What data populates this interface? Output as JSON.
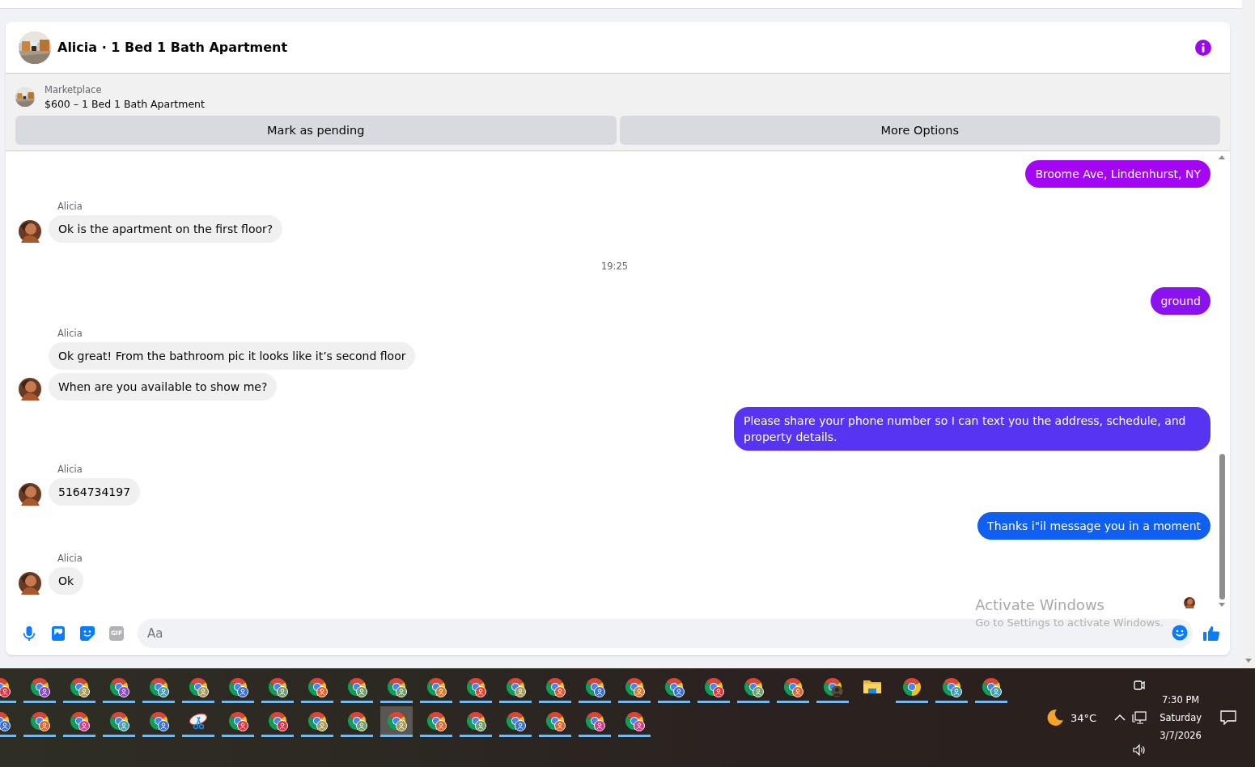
{
  "header": {
    "title": "Alicia · 1 Bed 1 Bath Apartment"
  },
  "listing": {
    "source": "Marketplace",
    "title": "$600 – 1 Bed 1 Bath Apartment",
    "buttons": [
      "Mark as pending",
      "More Options"
    ]
  },
  "messages": [
    {
      "kind": "outgoing",
      "text": "Broome Ave, Lindenhurst, NY",
      "color": "#a405f4"
    },
    {
      "kind": "incoming",
      "sender": "Alicia",
      "bubbles": [
        "Ok is the apartment on the first floor?"
      ]
    },
    {
      "kind": "time",
      "text": "19:25"
    },
    {
      "kind": "outgoing",
      "text": "ground",
      "color": "#8a12f0"
    },
    {
      "kind": "incoming",
      "sender": "Alicia",
      "bubbles": [
        "Ok great! From the bathroom pic it looks like it’s second floor",
        "When are you available to show me?"
      ]
    },
    {
      "kind": "outgoing",
      "text": "Please share your phone number so I can text you the address, schedule, and property details.",
      "color": "#5634f2"
    },
    {
      "kind": "incoming",
      "sender": "Alicia",
      "bubbles": [
        "5164734197"
      ]
    },
    {
      "kind": "outgoing",
      "text": "Thanks i\"il message you in a moment",
      "color": "#0f5ff3"
    },
    {
      "kind": "incoming",
      "sender": "Alicia",
      "bubbles": [
        "Ok"
      ]
    },
    {
      "kind": "seen"
    }
  ],
  "composer": {
    "gif_label": "GIF",
    "placeholder": "Aa"
  },
  "os_notice": {
    "title": "Activate Windows",
    "text": "Go to Settings to activate Windows."
  },
  "taskbar": {
    "rows": [
      [
        {
          "kind": "profile",
          "color": "#e8303d",
          "running": true,
          "selected": false
        },
        {
          "kind": "profile",
          "color": "#8e44c9",
          "running": true,
          "selected": false
        },
        {
          "kind": "profile",
          "color": "#a69a5c",
          "running": true,
          "selected": false
        },
        {
          "kind": "profile",
          "color": "#8e44c9",
          "running": true,
          "selected": false
        },
        {
          "kind": "profile",
          "color": "#3f9fb0",
          "running": true,
          "selected": false
        },
        {
          "kind": "profile",
          "color": "#a69a5c",
          "running": true,
          "selected": false
        },
        {
          "kind": "profile",
          "color": "#3a6fd8",
          "running": true,
          "selected": false
        },
        {
          "kind": "profile",
          "color": "#6f9e6a",
          "running": true,
          "selected": false
        },
        {
          "kind": "profile",
          "color": "#e8602a",
          "running": true,
          "selected": false
        },
        {
          "kind": "profile",
          "color": "#6f9e6a",
          "running": true,
          "selected": false
        },
        {
          "kind": "profile",
          "color": "#6f9e6a",
          "running": true,
          "selected": false
        },
        {
          "kind": "profile",
          "color": "#e07a28",
          "running": true,
          "selected": false
        },
        {
          "kind": "profile",
          "color": "#e8452e",
          "running": true,
          "selected": false
        },
        {
          "kind": "profile",
          "color": "#a69a5c",
          "running": true,
          "selected": false
        },
        {
          "kind": "profile",
          "color": "#e8552e",
          "running": true,
          "selected": false
        },
        {
          "kind": "profile",
          "color": "#3a6fd8",
          "running": true,
          "selected": false
        },
        {
          "kind": "profile",
          "color": "#e07a28",
          "running": true,
          "selected": false
        },
        {
          "kind": "profile",
          "color": "#3a6fd8",
          "running": true,
          "selected": false
        },
        {
          "kind": "profile",
          "color": "#e8303d",
          "running": true,
          "selected": false
        },
        {
          "kind": "profile",
          "color": "#6f9e6a",
          "running": true,
          "selected": false
        },
        {
          "kind": "profile",
          "color": "#e8602a",
          "running": true,
          "selected": false
        },
        {
          "kind": "photo-profile",
          "running": true,
          "selected": false
        },
        {
          "kind": "folder",
          "running": false,
          "selected": false
        },
        {
          "kind": "browser",
          "running": true,
          "selected": false
        },
        {
          "kind": "profile",
          "color": "#3f9fb0",
          "running": true,
          "selected": false
        },
        {
          "kind": "profile",
          "color": "#3f9fb0",
          "running": true,
          "selected": false
        }
      ],
      [
        {
          "kind": "profile",
          "color": "#3a6fd8",
          "running": true,
          "selected": false
        },
        {
          "kind": "profile",
          "color": "#e8602a",
          "running": true,
          "selected": false
        },
        {
          "kind": "profile",
          "color": "#d93a8e",
          "running": true,
          "selected": false
        },
        {
          "kind": "profile",
          "color": "#3f9fb0",
          "running": true,
          "selected": false
        },
        {
          "kind": "profile",
          "color": "#3a6fd8",
          "running": true,
          "selected": false
        },
        {
          "kind": "snip",
          "running": true,
          "selected": false
        },
        {
          "kind": "profile",
          "color": "#e8303d",
          "running": true,
          "selected": false
        },
        {
          "kind": "profile",
          "color": "#e8303d",
          "running": true,
          "selected": false
        },
        {
          "kind": "profile",
          "color": "#a69a5c",
          "running": true,
          "selected": false
        },
        {
          "kind": "profile",
          "color": "#6f9e6a",
          "running": true,
          "selected": false
        },
        {
          "kind": "profile",
          "color": "#a69a5c",
          "running": true,
          "selected": true
        },
        {
          "kind": "profile",
          "color": "#e8602a",
          "running": true,
          "selected": false
        },
        {
          "kind": "profile",
          "color": "#6f9e6a",
          "running": true,
          "selected": false
        },
        {
          "kind": "profile",
          "color": "#3a6fd8",
          "running": true,
          "selected": false
        },
        {
          "kind": "profile",
          "color": "#e8602a",
          "running": true,
          "selected": false
        },
        {
          "kind": "profile",
          "color": "#d93a8e",
          "running": true,
          "selected": false
        },
        {
          "kind": "profile",
          "color": "#d93a8e",
          "running": true,
          "selected": false
        }
      ]
    ],
    "weather": "34°C",
    "clock": {
      "time": "7:30 PM",
      "day": "Saturday",
      "date": "3/7/2026"
    }
  }
}
